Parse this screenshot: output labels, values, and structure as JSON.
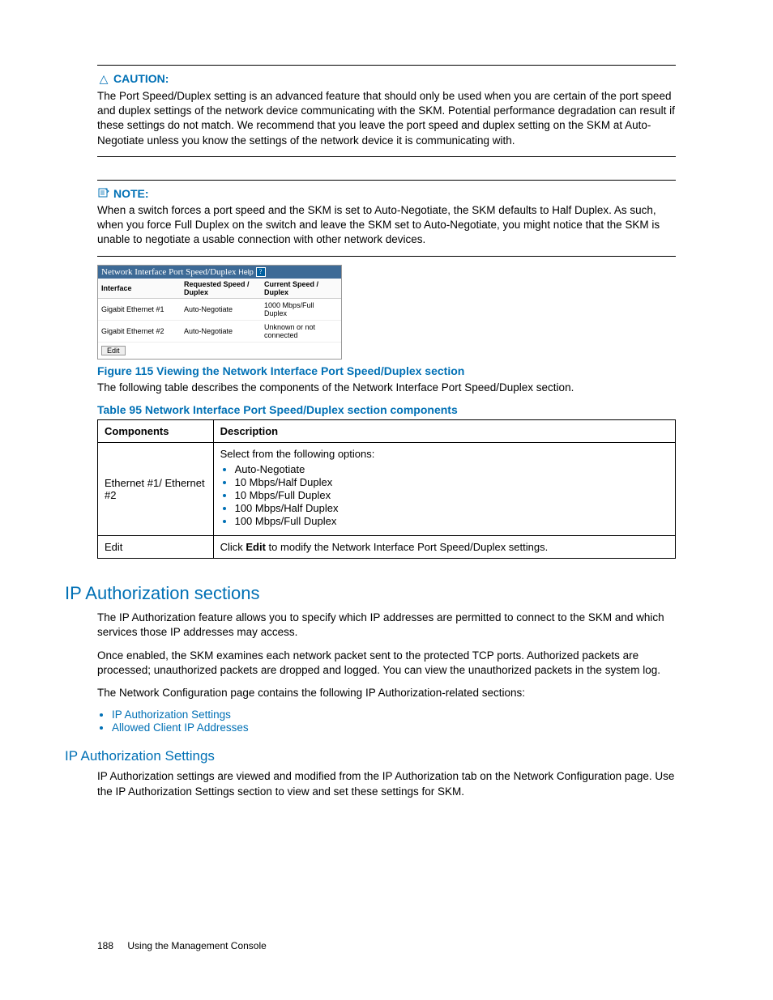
{
  "caution": {
    "label": "CAUTION:",
    "text": "The Port Speed/Duplex setting is an advanced feature that should only be used when you are certain of the port speed and duplex settings of the network device communicating with the SKM. Potential performance degradation can result if these settings do not match. We recommend that you leave the port speed and duplex setting on the SKM at Auto-Negotiate unless you know the settings of the network device it is communicating with."
  },
  "note": {
    "label": "NOTE:",
    "text": "When a switch forces a port speed and the SKM is set to Auto-Negotiate, the SKM defaults to Half Duplex. As such, when you force Full Duplex on the switch and leave the SKM set to Auto-Negotiate, you might notice that the SKM is unable to negotiate a usable connection with other network devices."
  },
  "screenshot": {
    "title": "Network Interface Port Speed/Duplex",
    "help": "Help",
    "cols": {
      "c1": "Interface",
      "c2": "Requested Speed / Duplex",
      "c3": "Current Speed / Duplex"
    },
    "rows": [
      {
        "c1": "Gigabit Ethernet #1",
        "c2": "Auto-Negotiate",
        "c3": "1000 Mbps/Full Duplex"
      },
      {
        "c1": "Gigabit Ethernet #2",
        "c2": "Auto-Negotiate",
        "c3": "Unknown or not connected"
      }
    ],
    "edit": "Edit"
  },
  "figure_caption": "Figure 115 Viewing the Network Interface Port Speed/Duplex section",
  "fig_body": "The following table describes the components of the Network Interface Port Speed/Duplex section.",
  "table_caption": "Table 95 Network Interface Port Speed/Duplex section components",
  "table": {
    "headers": {
      "h1": "Components",
      "h2": "Description"
    },
    "row1": {
      "comp": "Ethernet #1/ Ethernet #2",
      "intro": "Select from the following options:",
      "opts": [
        "Auto-Negotiate",
        "10 Mbps/Half Duplex",
        "10 Mbps/Full Duplex",
        "100 Mbps/Half Duplex",
        "100 Mbps/Full Duplex"
      ]
    },
    "row2": {
      "comp": "Edit",
      "desc_pre": "Click ",
      "desc_bold": "Edit",
      "desc_post": " to modify the Network Interface Port Speed/Duplex settings."
    }
  },
  "section1": {
    "title": "IP Authorization sections",
    "p1": "The IP Authorization feature allows you to specify which IP addresses are permitted to connect to the SKM and which services those IP addresses may access.",
    "p2": "Once enabled, the SKM examines each network packet sent to the protected TCP ports. Authorized packets are processed; unauthorized packets are dropped and logged. You can view the unauthorized packets in the system log.",
    "p3": "The Network Configuration page contains the following IP Authorization-related sections:",
    "links": [
      "IP Authorization Settings",
      "Allowed Client IP Addresses"
    ]
  },
  "section2": {
    "title": "IP Authorization Settings",
    "p1": "IP Authorization settings are viewed and modified from the IP Authorization tab on the Network Configuration page. Use the IP Authorization Settings section to view and set these settings for SKM."
  },
  "footer": {
    "page": "188",
    "title": "Using the Management Console"
  }
}
